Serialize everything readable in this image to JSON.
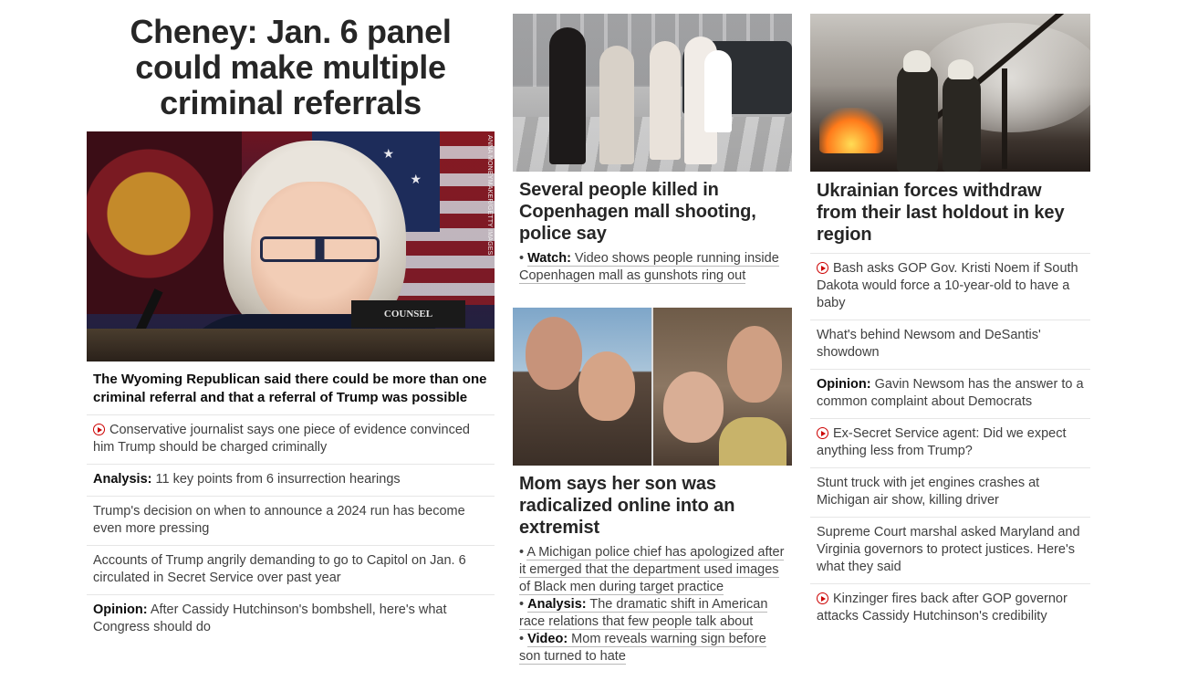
{
  "lead": {
    "headline": "Cheney: Jan. 6 panel could make multiple criminal referrals",
    "image_credit": "ANNA MONEYMAKER/GETTY IMAGES",
    "placard_text": "COUNSEL",
    "description": "The Wyoming Republican said there could be more than one criminal referral and that a referral of Trump was possible",
    "items": [
      {
        "video": true,
        "prefix": "",
        "text": "Conservative journalist says one piece of evidence convinced him Trump should be charged criminally"
      },
      {
        "video": false,
        "prefix": "Analysis:",
        "text": " 11 key points from 6 insurrection hearings"
      },
      {
        "video": false,
        "prefix": "",
        "text": "Trump's decision on when to announce a 2024 run has become even more pressing"
      },
      {
        "video": false,
        "prefix": "",
        "text": "Accounts of Trump angrily demanding to go to Capitol on Jan. 6 circulated in Secret Service over past year"
      },
      {
        "video": false,
        "prefix": "Opinion:",
        "text": " After Cassidy Hutchinson's bombshell, here's what Congress should do"
      }
    ]
  },
  "copenhagen": {
    "headline": "Several people killed in Copenhagen mall shooting, police say",
    "related": [
      {
        "bullet": "• ",
        "prefix": "Watch:",
        "text": " Video shows people running inside Copenhagen mall as gunshots ring out"
      }
    ]
  },
  "mom": {
    "headline": "Mom says her son was radicalized online into an extremist",
    "related": [
      {
        "bullet": "• ",
        "prefix": "",
        "text": "A Michigan police chief has apologized after it emerged that the department used images of Black men during target practice"
      },
      {
        "bullet": "• ",
        "prefix": "Analysis:",
        "text": " The dramatic shift in American race relations that few people talk about"
      },
      {
        "bullet": "• ",
        "prefix": "Video:",
        "text": " Mom reveals warning sign before son turned to hate"
      }
    ]
  },
  "ukraine": {
    "headline": "Ukrainian forces withdraw from their last holdout in key region",
    "items": [
      {
        "video": true,
        "prefix": "",
        "text": "Bash asks GOP Gov. Kristi Noem if South Dakota would force a 10-year-old to have a baby"
      },
      {
        "video": false,
        "prefix": "",
        "text": "What's behind Newsom and DeSantis' showdown"
      },
      {
        "video": false,
        "prefix": "Opinion:",
        "text": " Gavin Newsom has the answer to a common complaint about Democrats"
      },
      {
        "video": true,
        "prefix": "",
        "text": "Ex-Secret Service agent: Did we expect anything less from Trump?"
      },
      {
        "video": false,
        "prefix": "",
        "text": "Stunt truck with jet engines crashes at Michigan air show, killing driver"
      },
      {
        "video": false,
        "prefix": "",
        "text": "Supreme Court marshal asked Maryland and Virginia governors to protect justices. Here's what they said"
      },
      {
        "video": true,
        "prefix": "",
        "text": "Kinzinger fires back after GOP governor attacks Cassidy Hutchinson's credibility"
      }
    ]
  },
  "colors": {
    "text": "#0c0c0c",
    "secondary": "#404040",
    "video_icon": "#cc0000",
    "divider": "#e6e6e6"
  },
  "icons": {
    "video": "play-circle-icon"
  }
}
